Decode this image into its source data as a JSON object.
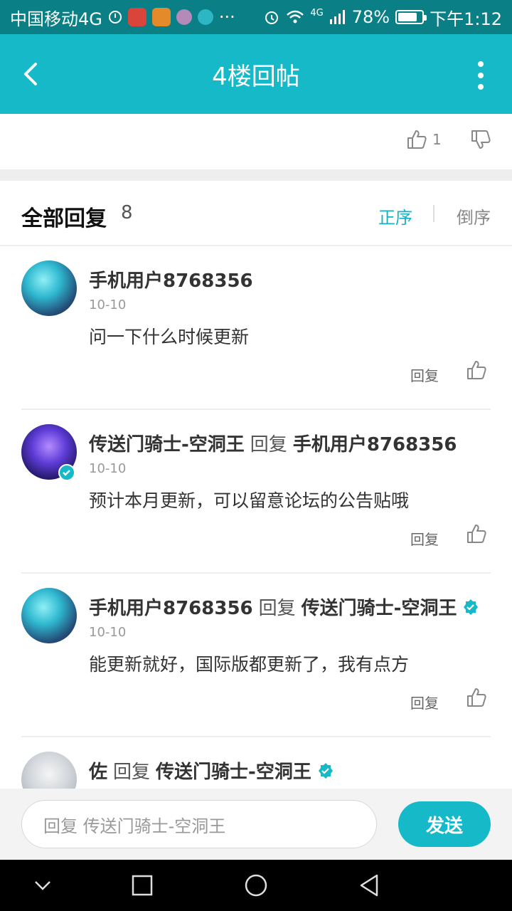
{
  "status_bar": {
    "carrier": "中国移动4G",
    "more": "···",
    "network": "4G",
    "battery": "78%",
    "battery_level": 0.78,
    "time": "下午1:12"
  },
  "app_bar": {
    "title": "4楼回帖"
  },
  "vote": {
    "like_count": "1"
  },
  "replies_header": {
    "label": "全部回复",
    "count": "8",
    "sort_asc": "正序",
    "sort_desc": "倒序"
  },
  "comments": [
    {
      "author": "手机用户8768356",
      "reply_word": "",
      "target": "",
      "date": "10-10",
      "text": "问一下什么时候更新",
      "reply_label": "回复"
    },
    {
      "author": "传送门骑士-空洞王",
      "reply_word": "回复",
      "target": "手机用户8768356",
      "date": "10-10",
      "text": "预计本月更新，可以留意论坛的公告贴哦",
      "reply_label": "回复"
    },
    {
      "author": "手机用户8768356",
      "reply_word": "回复",
      "target": "传送门骑士-空洞王",
      "date": "10-10",
      "text": "能更新就好，国际版都更新了，我有点方",
      "reply_label": "回复"
    },
    {
      "author": "佐",
      "reply_word": "回复",
      "target": "传送门骑士-空洞王",
      "date": "",
      "text": "",
      "reply_label": ""
    }
  ],
  "input_bar": {
    "placeholder": "回复 传送门骑士-空洞王",
    "send_label": "发送"
  },
  "colors": {
    "status_bar": "#0a7f86",
    "accent": "#16b9c8",
    "sort_active": "#16b0c0"
  }
}
